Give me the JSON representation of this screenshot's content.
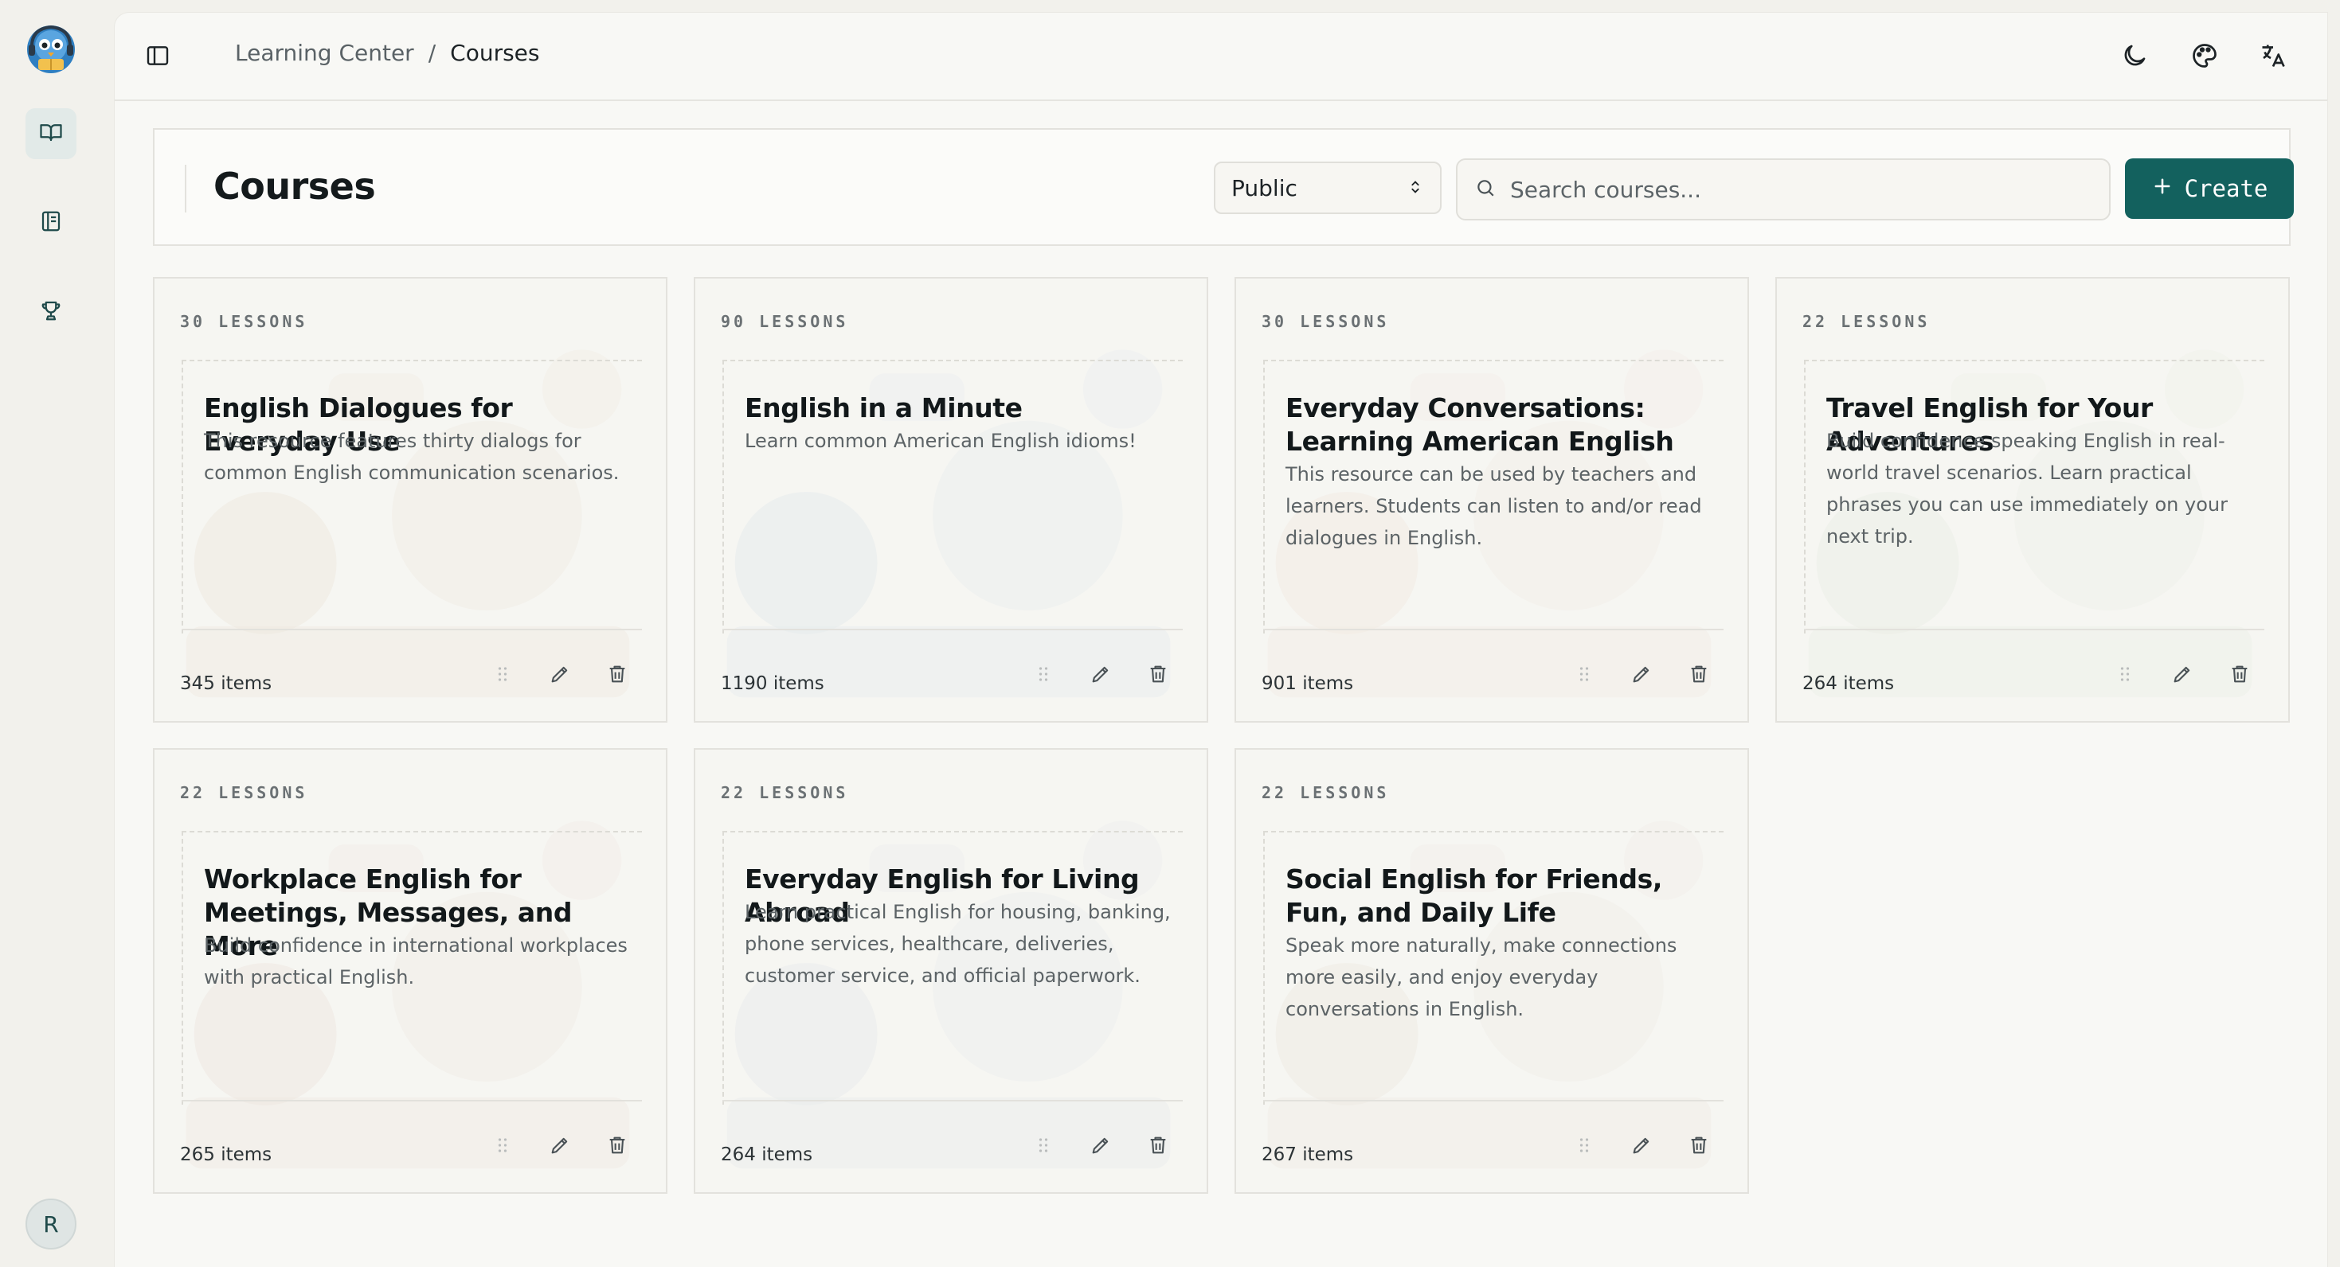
{
  "app": {
    "logo_icon": "mascot-logo-icon",
    "avatar_initial": "R",
    "accent": "#13615e"
  },
  "rail": {
    "items": [
      {
        "icon": "book-open-icon",
        "active": true
      },
      {
        "icon": "notebook-icon",
        "active": false
      },
      {
        "icon": "trophy-icon",
        "active": false
      }
    ]
  },
  "topbar": {
    "breadcrumb": {
      "root": "Learning Center",
      "separator": "/",
      "current": "Courses"
    },
    "icons": [
      "moon-icon",
      "palette-icon",
      "translate-icon"
    ]
  },
  "header": {
    "title": "Courses",
    "visibility": "Public",
    "search_placeholder": "Search courses...",
    "search_value": "",
    "create_label": "Create"
  },
  "courses": [
    {
      "lessons": "30 LESSONS",
      "title": "English Dialogues for Everyday Use",
      "description": "This resource features thirty dialogs for common English communication scenarios.",
      "items": "345 items"
    },
    {
      "lessons": "90 LESSONS",
      "title": "English in a Minute",
      "description": "Learn common American English idioms!",
      "items": "1190 items"
    },
    {
      "lessons": "30 LESSONS",
      "title": "Everyday Conversations: Learning American English",
      "description": "This resource can be used by teachers and learners. Students can listen to and/or read dialogues in English.",
      "items": "901 items"
    },
    {
      "lessons": "22 LESSONS",
      "title": "Travel English for Your Adventures",
      "description": "Build confidence speaking English in real-world travel scenarios. Learn practical phrases you can use immediately on your next trip.",
      "items": "264 items"
    },
    {
      "lessons": "22 LESSONS",
      "title": "Workplace English for Meetings, Messages, and More",
      "description": "Build confidence in international workplaces with practical English.",
      "items": "265 items"
    },
    {
      "lessons": "22 LESSONS",
      "title": "Everyday English for Living Abroad",
      "description": "Learn practical English for housing, banking, phone services, healthcare, deliveries, customer service, and official paperwork.",
      "items": "264 items"
    },
    {
      "lessons": "22 LESSONS",
      "title": "Social English for Friends, Fun, and Daily Life",
      "description": "Speak more naturally, make connections more easily, and enjoy everyday conversations in English.",
      "items": "267 items"
    }
  ]
}
